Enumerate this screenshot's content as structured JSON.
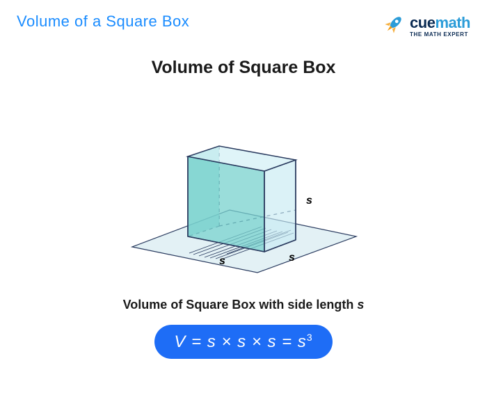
{
  "header": {
    "title": "Volume of a Square Box",
    "logo_main_cue": "cue",
    "logo_main_math": "math",
    "logo_sub": "THE MATH EXPERT"
  },
  "card": {
    "title": "Volume of Square Box",
    "side_label": "s",
    "caption_prefix": "Volume of Square Box with side length ",
    "caption_var": "s",
    "formula_html": "V = s × s × s = s³"
  },
  "colors": {
    "accent_blue": "#1a8cff",
    "pill_blue": "#1e6df6",
    "cube_fill": "#b6e6e2",
    "plane_fill": "#e3f1f5",
    "stroke": "#0b2b53"
  }
}
